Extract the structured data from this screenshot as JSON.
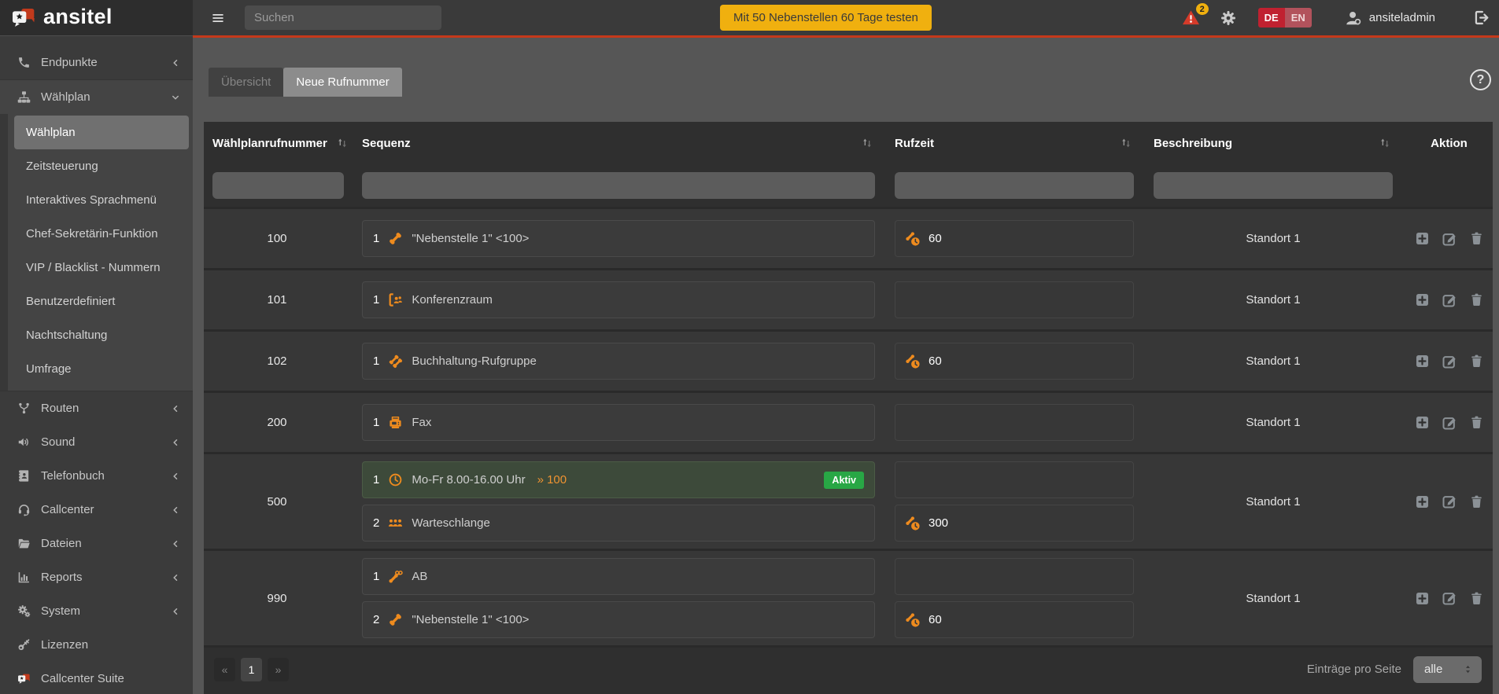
{
  "topbar": {
    "logo_text": "ansitel",
    "search_placeholder": "Suchen",
    "trial_button_label": "Mit 50 Nebenstellen 60 Tage testen",
    "warning_badge_count": "2",
    "language": {
      "de": "DE",
      "en": "EN"
    },
    "username": "ansiteladmin"
  },
  "sidebar": {
    "items": [
      {
        "label": "Endpunkte"
      },
      {
        "label": "Wählplan"
      },
      {
        "label": "Routen"
      },
      {
        "label": "Sound"
      },
      {
        "label": "Telefonbuch"
      },
      {
        "label": "Callcenter"
      },
      {
        "label": "Dateien"
      },
      {
        "label": "Reports"
      },
      {
        "label": "System"
      },
      {
        "label": "Lizenzen"
      },
      {
        "label": "Callcenter Suite"
      }
    ],
    "waehlplan_submenu": [
      {
        "label": "Wählplan",
        "selected": true
      },
      {
        "label": "Zeitsteuerung"
      },
      {
        "label": "Interaktives Sprachmenü"
      },
      {
        "label": "Chef-Sekretärin-Funktion"
      },
      {
        "label": "VIP / Blacklist - Nummern"
      },
      {
        "label": "Benutzerdefiniert"
      },
      {
        "label": "Nachtschaltung"
      },
      {
        "label": "Umfrage"
      }
    ]
  },
  "tabs": [
    {
      "label": "Übersicht",
      "active": false
    },
    {
      "label": "Neue Rufnummer",
      "active": true
    }
  ],
  "help_label": "?",
  "table": {
    "columns": [
      {
        "label": "Wählplanrufnummer",
        "sortable": true
      },
      {
        "label": "Sequenz",
        "sortable": true
      },
      {
        "label": "Rufzeit",
        "sortable": true
      },
      {
        "label": "Beschreibung",
        "sortable": true
      },
      {
        "label": "Aktion",
        "sortable": false
      }
    ],
    "rows": [
      {
        "number": "100",
        "description": "Standort 1",
        "steps": [
          {
            "n": "1",
            "icon": "receiver",
            "text": "\"Nebenstelle 1\" <100>",
            "ringtime": "60"
          }
        ]
      },
      {
        "number": "101",
        "description": "Standort 1",
        "steps": [
          {
            "n": "1",
            "icon": "conference",
            "text": "Konferenzraum",
            "ringtime": ""
          }
        ]
      },
      {
        "number": "102",
        "description": "Standort 1",
        "steps": [
          {
            "n": "1",
            "icon": "ringgroup",
            "text": "Buchhaltung-Rufgruppe",
            "ringtime": "60"
          }
        ]
      },
      {
        "number": "200",
        "description": "Standort 1",
        "steps": [
          {
            "n": "1",
            "icon": "fax",
            "text": "Fax",
            "ringtime": ""
          }
        ]
      },
      {
        "number": "500",
        "description": "Standort 1",
        "steps": [
          {
            "n": "1",
            "icon": "clock",
            "text": "Mo-Fr 8.00-16.00 Uhr",
            "jump": "» 100",
            "badge": "Aktiv",
            "active": true,
            "ringtime": ""
          },
          {
            "n": "2",
            "icon": "users",
            "text": "Warteschlange",
            "ringtime": "300"
          }
        ]
      },
      {
        "number": "990",
        "description": "Standort 1",
        "steps": [
          {
            "n": "1",
            "icon": "voicemail",
            "text": "AB",
            "ringtime": ""
          },
          {
            "n": "2",
            "icon": "receiver",
            "text": "\"Nebenstelle 1\" <100>",
            "ringtime": "60"
          }
        ]
      }
    ]
  },
  "pagination": {
    "prev": "«",
    "current_page": "1",
    "next": "»",
    "per_page_label": "Einträge pro Seite",
    "per_page_value": "alle"
  },
  "colors": {
    "accent_orange": "#ee8b1e",
    "accent_red_line": "#c5391b",
    "trial_yellow": "#f0b00f",
    "active_green": "#28a745",
    "lang_de_red": "#c02130"
  }
}
